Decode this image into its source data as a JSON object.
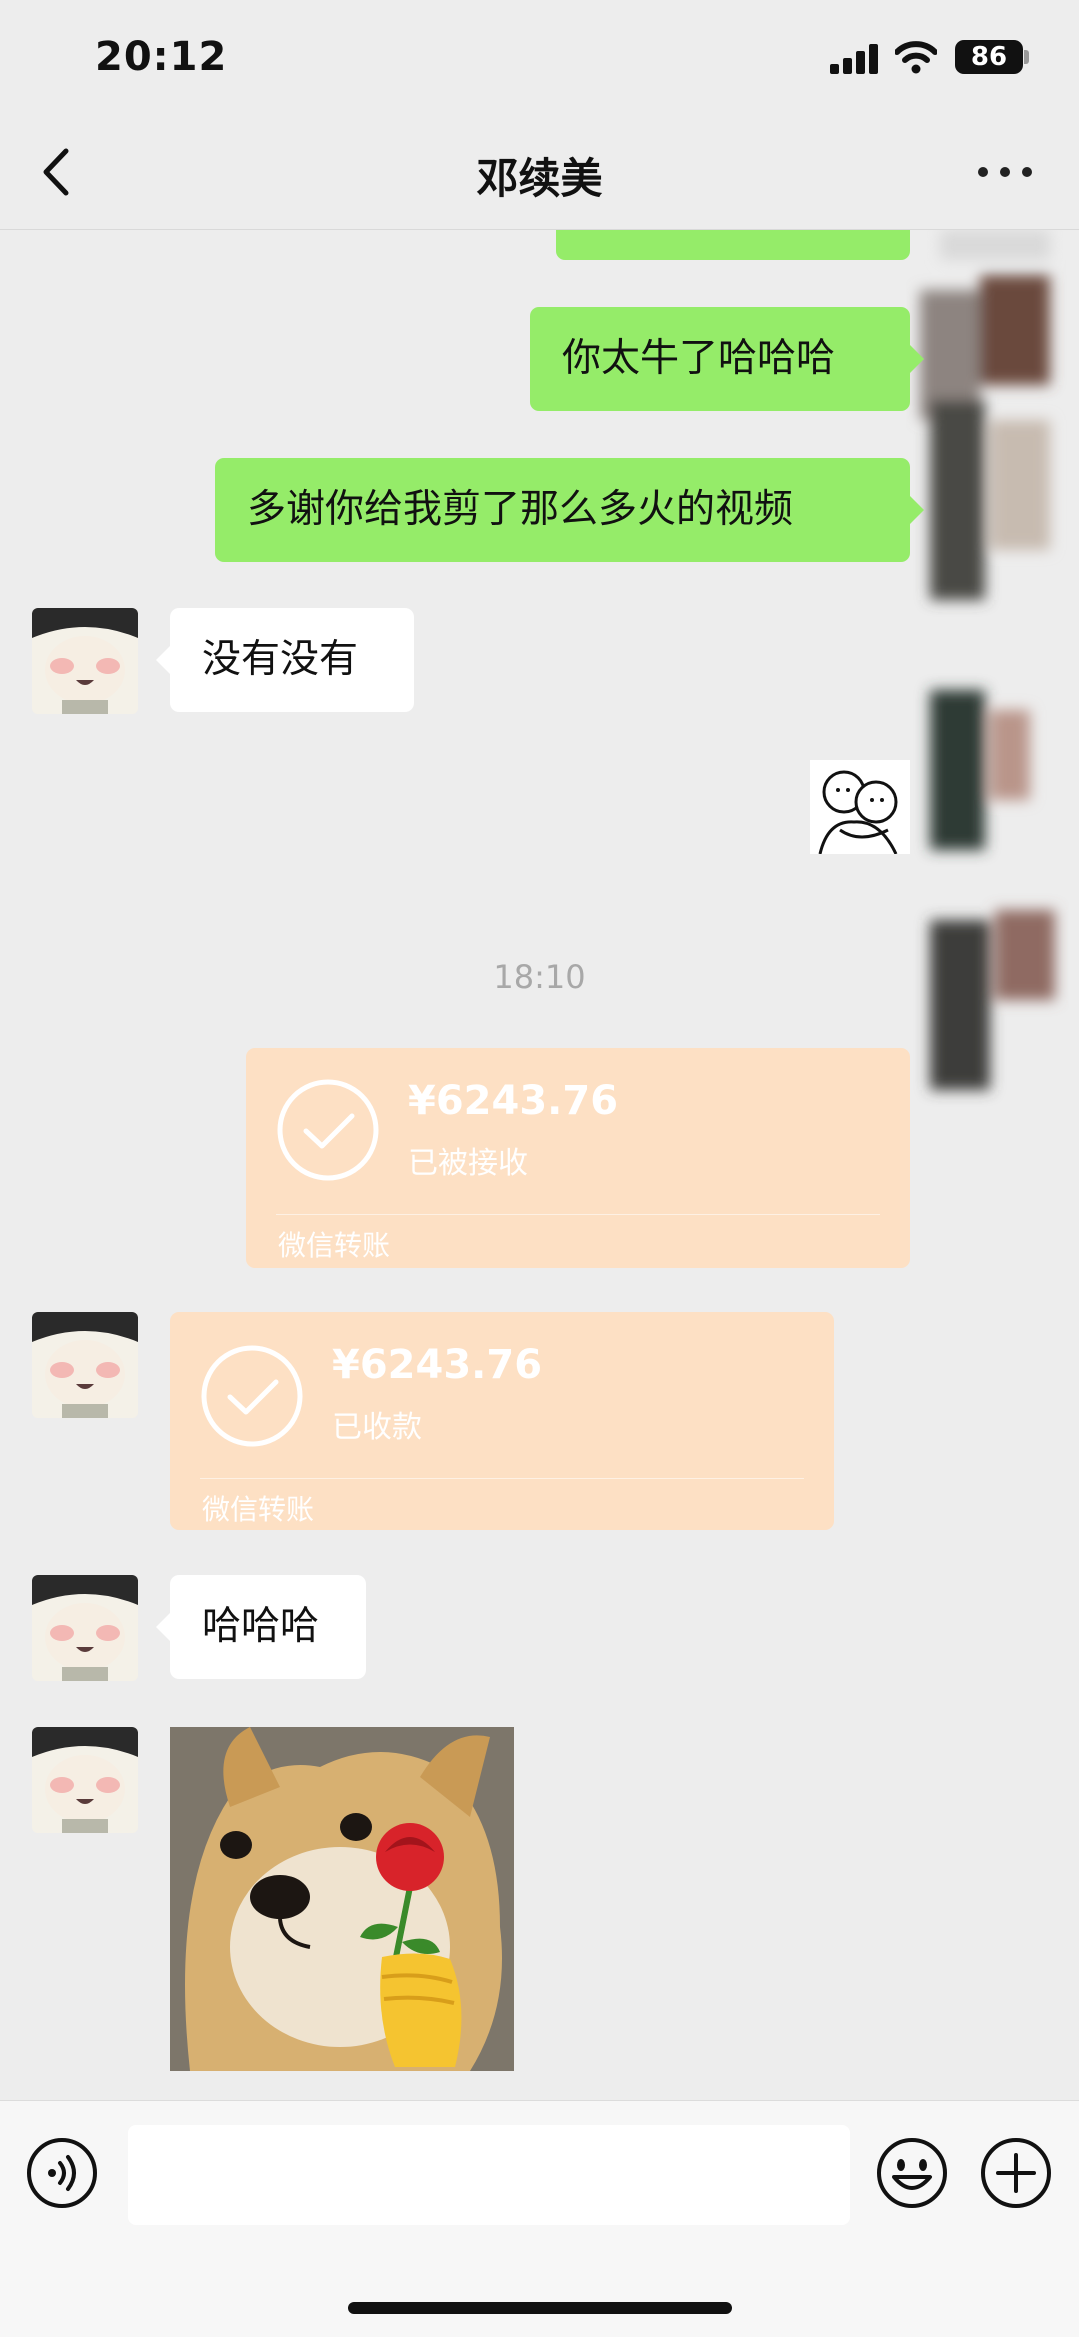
{
  "status_bar": {
    "time": "20:12",
    "battery": "86"
  },
  "header": {
    "title": "邓续美"
  },
  "messages": {
    "m1": "你太牛了哈哈哈",
    "m2": "多谢你给我剪了那么多火的视频",
    "m3": "没有没有",
    "m6": "哈哈哈"
  },
  "timestamp": "18:10",
  "transfers": {
    "sent": {
      "amount": "¥6243.76",
      "status": "已被接收",
      "label": "微信转账"
    },
    "received": {
      "amount": "¥6243.76",
      "status": "已收款",
      "label": "微信转账"
    }
  },
  "colors": {
    "sent_bubble": "#95ec69",
    "received_bubble": "#ffffff",
    "transfer_card": "#fde0c4",
    "background": "#ededed"
  },
  "icons": [
    "back-arrow-icon",
    "more-icon",
    "voice-icon",
    "emoji-icon",
    "plus-icon"
  ],
  "input": {
    "value": ""
  }
}
